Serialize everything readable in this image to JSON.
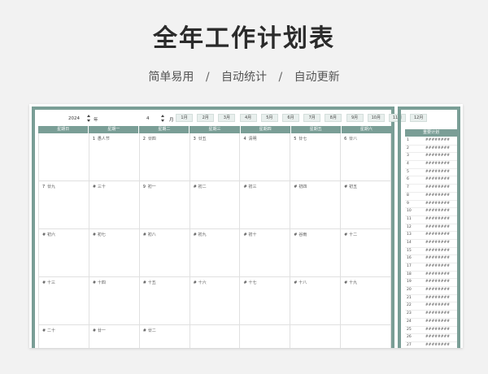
{
  "header": {
    "title": "全年工作计划表",
    "subtitle_parts": [
      "简单易用",
      "自动统计",
      "自动更新"
    ],
    "separator": "/"
  },
  "controls": {
    "year_value": "2024",
    "year_unit": "年",
    "month_value": "4",
    "month_unit": "月",
    "month_buttons": [
      "1月",
      "2月",
      "3月",
      "4月",
      "5月",
      "6月",
      "7月",
      "8月",
      "9月",
      "10月",
      "11月",
      "12月"
    ]
  },
  "calendar": {
    "weekdays": [
      "星期日",
      "星期一",
      "星期二",
      "星期三",
      "星期四",
      "星期五",
      "星期六"
    ],
    "weeks": [
      [
        [
          "",
          ""
        ],
        [
          "1",
          "愚人节"
        ],
        [
          "2",
          "廿四"
        ],
        [
          "3",
          "廿五"
        ],
        [
          "4",
          "清明"
        ],
        [
          "5",
          "廿七"
        ],
        [
          "6",
          "廿八"
        ]
      ],
      [
        [
          "7",
          "廿九"
        ],
        [
          "#",
          "三十"
        ],
        [
          "9",
          "初一"
        ],
        [
          "#",
          "初二"
        ],
        [
          "#",
          "初三"
        ],
        [
          "#",
          "初四"
        ],
        [
          "#",
          "初五"
        ]
      ],
      [
        [
          "#",
          "初六"
        ],
        [
          "#",
          "初七"
        ],
        [
          "#",
          "初八"
        ],
        [
          "#",
          "初九"
        ],
        [
          "#",
          "初十"
        ],
        [
          "#",
          "谷雨"
        ],
        [
          "#",
          "十二"
        ]
      ],
      [
        [
          "#",
          "十三"
        ],
        [
          "#",
          "十四"
        ],
        [
          "#",
          "十五"
        ],
        [
          "#",
          "十六"
        ],
        [
          "#",
          "十七"
        ],
        [
          "#",
          "十八"
        ],
        [
          "#",
          "十九"
        ]
      ],
      [
        [
          "#",
          "二十"
        ],
        [
          "#",
          "廿一"
        ],
        [
          "#",
          "廿二"
        ],
        [
          "",
          ""
        ],
        [
          "",
          ""
        ],
        [
          "",
          ""
        ],
        [
          "",
          ""
        ]
      ]
    ]
  },
  "sidebar": {
    "heading": "重要计划",
    "items": [
      {
        "n": "1",
        "v": "########"
      },
      {
        "n": "2",
        "v": "########"
      },
      {
        "n": "3",
        "v": "########"
      },
      {
        "n": "4",
        "v": "########"
      },
      {
        "n": "5",
        "v": "########"
      },
      {
        "n": "6",
        "v": "########"
      },
      {
        "n": "7",
        "v": "########"
      },
      {
        "n": "8",
        "v": "########"
      },
      {
        "n": "9",
        "v": "########"
      },
      {
        "n": "10",
        "v": "########"
      },
      {
        "n": "11",
        "v": "########"
      },
      {
        "n": "12",
        "v": "########"
      },
      {
        "n": "13",
        "v": "########"
      },
      {
        "n": "14",
        "v": "########"
      },
      {
        "n": "15",
        "v": "########"
      },
      {
        "n": "16",
        "v": "########"
      },
      {
        "n": "17",
        "v": "########"
      },
      {
        "n": "18",
        "v": "########"
      },
      {
        "n": "19",
        "v": "########"
      },
      {
        "n": "20",
        "v": "########"
      },
      {
        "n": "21",
        "v": "########"
      },
      {
        "n": "22",
        "v": "########"
      },
      {
        "n": "23",
        "v": "########"
      },
      {
        "n": "24",
        "v": "########"
      },
      {
        "n": "25",
        "v": "########"
      },
      {
        "n": "26",
        "v": "########"
      },
      {
        "n": "27",
        "v": "########"
      }
    ]
  },
  "colors": {
    "accent": "#7a9e96",
    "background": "#f2f2f2"
  }
}
